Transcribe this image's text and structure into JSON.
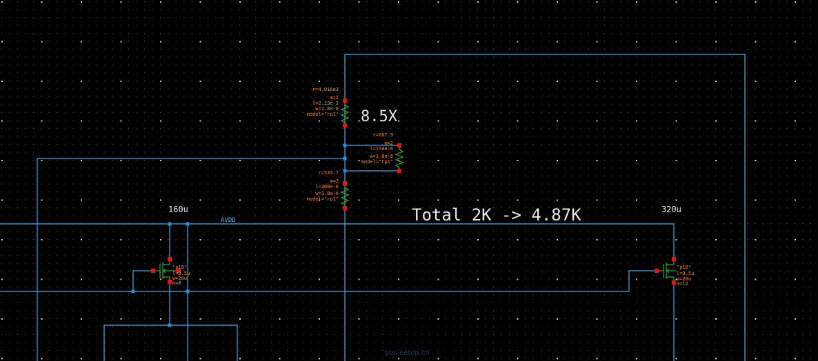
{
  "annotations": {
    "ratio_text": "8.5X",
    "total_text": "Total 2K -> 4.87K",
    "pmos_left_width": "160u",
    "pmos_right_width": "320u",
    "net_avdd": "AVDD"
  },
  "resistors": {
    "r_top": {
      "r": "r=4.016e3",
      "m": "m=2",
      "l": "l=2.23e-3",
      "w": "w=1.8e-6",
      "model": "model=\"rp1\""
    },
    "r_mid": {
      "r": "r=267.9",
      "m": "m=2",
      "l": "l=158e-6",
      "w": "w=1.8e-6",
      "model": "model=\"rp1\""
    },
    "r_bot": {
      "r": "r=535.7",
      "m": "m=2",
      "l": "l=300e-6",
      "w": "w=1.8e-6",
      "model": "model=\"rp1\""
    }
  },
  "mosfets": {
    "m_left": {
      "model": "\"p18\"",
      "l": "l=3.5u",
      "w": "w=20u",
      "m": "m=8"
    },
    "m_right": {
      "model": "\"p18\"",
      "l": "l=3.5u",
      "w": "w=20u",
      "m": "m=12"
    }
  },
  "watermark": "bbs.eetop.cn",
  "colors": {
    "background": "#000000",
    "wire": "#4aa8e8",
    "pin": "#ee1111",
    "device": "#2fae2f",
    "property_text": "#ff8a2a",
    "annotation_text": "#e8e8e8"
  }
}
